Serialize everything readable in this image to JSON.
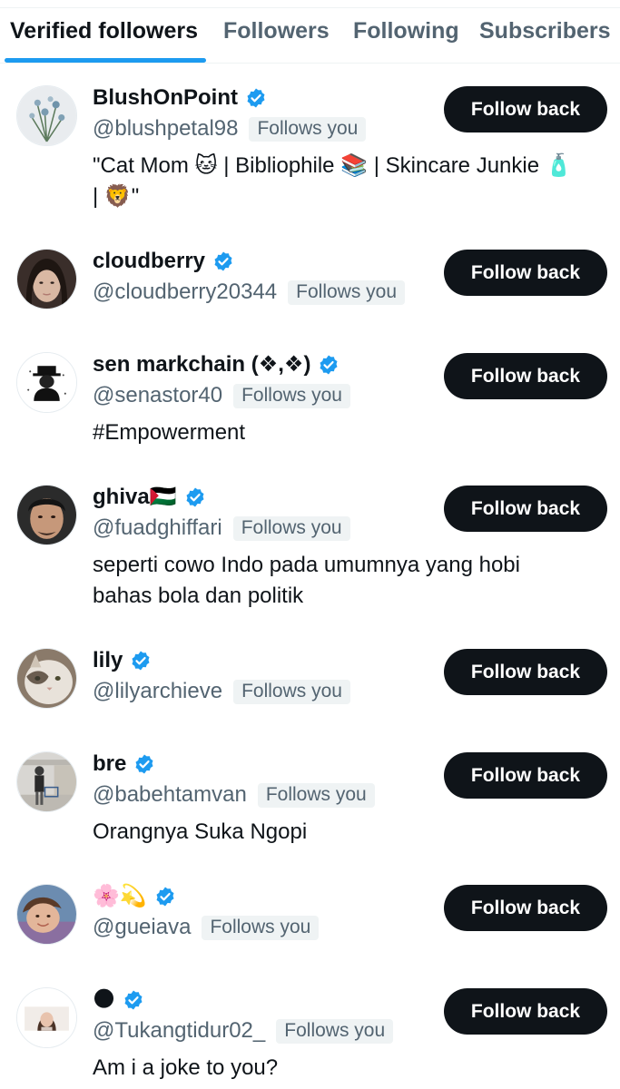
{
  "tabs": [
    {
      "label": "Verified followers",
      "active": true
    },
    {
      "label": "Followers",
      "active": false
    },
    {
      "label": "Following",
      "active": false
    },
    {
      "label": "Subscribers",
      "active": false
    }
  ],
  "colors": {
    "accent": "#1d9bf0",
    "button_bg": "#0f1419",
    "secondary_text": "#536471",
    "badge_bg": "#eff3f4"
  },
  "follows_you_label": "Follows you",
  "follow_back_label": "Follow back",
  "users": [
    {
      "name": "BlushOnPoint",
      "handle": "@blushpetal98",
      "bio": "\"Cat Mom 🐱 | Bibliophile 📚 | Skincare Junkie 🧴 | 🦁\"",
      "avatar_icon": "flower-bouquet"
    },
    {
      "name": "cloudberry",
      "handle": "@cloudberry20344",
      "bio": "",
      "avatar_icon": "woman-portrait"
    },
    {
      "name": "sen markchain (❖,❖)",
      "handle": "@senastor40",
      "bio": "#Empowerment",
      "avatar_icon": "hat-figure"
    },
    {
      "name": "ghiva🇵🇸",
      "handle": "@fuadghiffari",
      "bio": "seperti cowo Indo pada umumnya yang hobi bahas bola dan politik",
      "avatar_icon": "man-portrait"
    },
    {
      "name": "lily",
      "handle": "@lilyarchieve",
      "bio": "",
      "avatar_icon": "cat-photo"
    },
    {
      "name": "bre",
      "handle": "@babehtamvan",
      "bio": "Orangnya Suka Ngopi",
      "avatar_icon": "supermarket-photo"
    },
    {
      "name": "🌸💫",
      "handle": "@gueiava",
      "bio": "",
      "avatar_icon": "baby-photo"
    },
    {
      "name": "🌑",
      "handle": "@Tukangtidur02_",
      "bio": "Am i a joke to you?",
      "avatar_icon": "selfie-photo"
    }
  ]
}
